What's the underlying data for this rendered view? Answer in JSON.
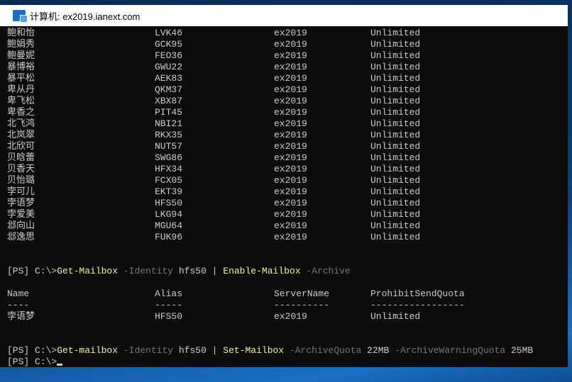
{
  "window": {
    "title": "计算机: ex2019.ianext.com",
    "icon": "remote-desktop-icon"
  },
  "rows": [
    [
      "鲍和怡",
      "LVK46",
      "ex2019",
      "Unlimited"
    ],
    [
      "鲍娟秀",
      "GCK95",
      "ex2019",
      "Unlimited"
    ],
    [
      "鲍曼妮",
      "FEO36",
      "ex2019",
      "Unlimited"
    ],
    [
      "暴博裕",
      "GWU22",
      "ex2019",
      "Unlimited"
    ],
    [
      "暴平松",
      "AEK83",
      "ex2019",
      "Unlimited"
    ],
    [
      "卑从丹",
      "QKM37",
      "ex2019",
      "Unlimited"
    ],
    [
      "卑飞松",
      "XBX87",
      "ex2019",
      "Unlimited"
    ],
    [
      "卑香之",
      "PIT45",
      "ex2019",
      "Unlimited"
    ],
    [
      "北飞鸿",
      "NBI21",
      "ex2019",
      "Unlimited"
    ],
    [
      "北岚翠",
      "RKX35",
      "ex2019",
      "Unlimited"
    ],
    [
      "北欣可",
      "NUT57",
      "ex2019",
      "Unlimited"
    ],
    [
      "贝晗蕾",
      "SWG86",
      "ex2019",
      "Unlimited"
    ],
    [
      "贝香天",
      "HFX34",
      "ex2019",
      "Unlimited"
    ],
    [
      "贝怡璐",
      "FCX05",
      "ex2019",
      "Unlimited"
    ],
    [
      "孛可儿",
      "EKT39",
      "ex2019",
      "Unlimited"
    ],
    [
      "孛语梦",
      "HFS50",
      "ex2019",
      "Unlimited"
    ],
    [
      "孛爱美",
      "LKG94",
      "ex2019",
      "Unlimited"
    ],
    [
      "邶向山",
      "MGU64",
      "ex2019",
      "Unlimited"
    ],
    [
      "邶逸思",
      "FUK96",
      "ex2019",
      "Unlimited"
    ]
  ],
  "cmd1": {
    "prompt": "[PS] C:\\>",
    "c1": "Get-Mailbox",
    "p1": " -Identity",
    "v1": " hfs50 | ",
    "c2": "Enable-Mailbox",
    "p2": " -Archive"
  },
  "headers": [
    "Name",
    "Alias",
    "ServerName",
    "ProhibitSendQuota"
  ],
  "dashes": [
    "----",
    "-----",
    "----------",
    "-----------------"
  ],
  "result": [
    "孛语梦",
    "HFS50",
    "ex2019",
    "Unlimited"
  ],
  "cmd2": {
    "prompt": "[PS] C:\\>",
    "c1": "Get-mailbox",
    "p1": " -Identity",
    "v1": " hfs50 | ",
    "c2": "Set-Mailbox",
    "p2": " -ArchiveQuota",
    "v2": " 22MB",
    "p3": " -ArchiveWarningQuota",
    "v3": " 25MB"
  },
  "prompt": "[PS] C:\\>"
}
